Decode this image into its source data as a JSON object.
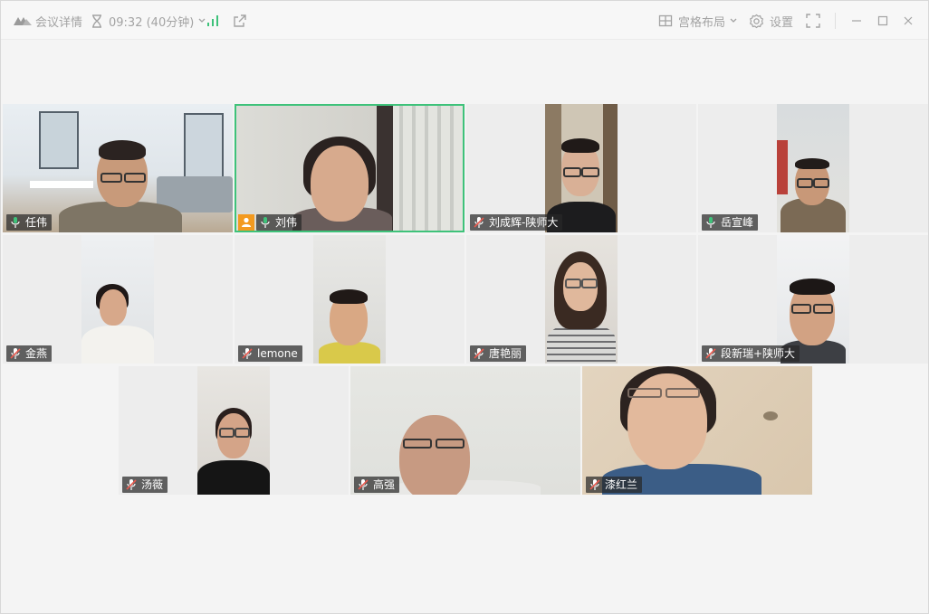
{
  "titlebar": {
    "meeting_details_label": "会议详情",
    "duration_label": "09:32 (40分钟)",
    "layout_label": "宫格布局",
    "settings_label": "设置"
  },
  "participants": [
    {
      "name": "任伟",
      "mic": "on"
    },
    {
      "name": "刘伟",
      "mic": "on",
      "speaking": true,
      "host": true
    },
    {
      "name": "刘成辉-陕师大",
      "mic": "off"
    },
    {
      "name": "岳宣峰",
      "mic": "on"
    },
    {
      "name": "金燕",
      "mic": "off"
    },
    {
      "name": "lemone",
      "mic": "off"
    },
    {
      "name": "唐艳丽",
      "mic": "off"
    },
    {
      "name": "段新瑞+陕师大",
      "mic": "off"
    },
    {
      "name": "汤薇",
      "mic": "off"
    },
    {
      "name": "高强",
      "mic": "off"
    },
    {
      "name": "漆红兰",
      "mic": "off"
    }
  ],
  "colors": {
    "speaking_border": "#3ec27a",
    "host_badge": "#f39a1f",
    "mic_on": "#3ec27a",
    "mic_off": "#e85a4f",
    "signal": "#3ec27a"
  },
  "icons": [
    "app-logo-icon",
    "hourglass-icon",
    "chevron-down-icon",
    "signal-bars-icon",
    "share-icon",
    "grid-layout-icon",
    "gear-icon",
    "fullscreen-icon",
    "minimize-icon",
    "maximize-icon",
    "close-icon",
    "mic-on-icon",
    "mic-off-icon",
    "host-icon"
  ]
}
